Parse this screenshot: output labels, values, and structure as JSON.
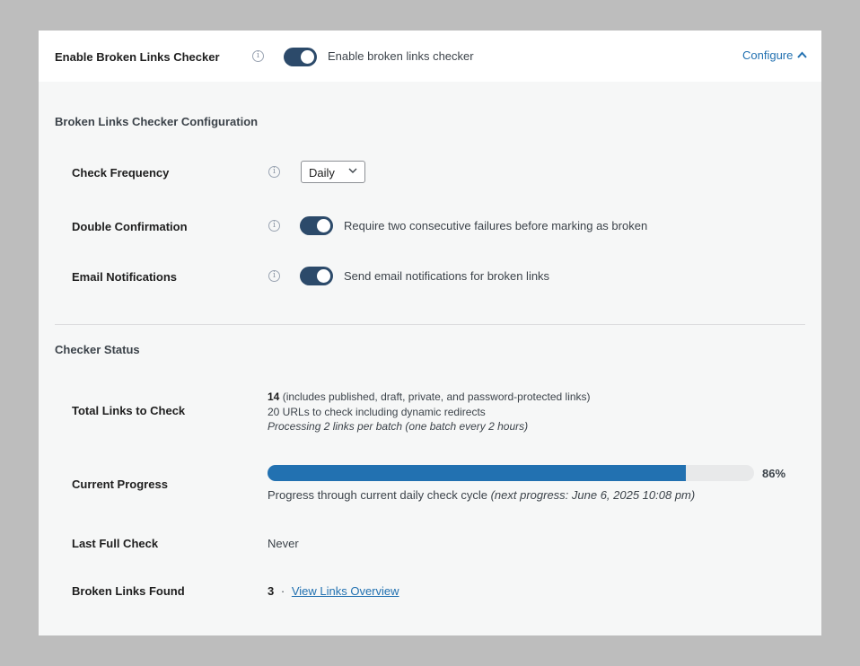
{
  "header": {
    "title": "Enable Broken Links Checker",
    "toggle_label": "Enable broken links checker",
    "toggle_on": true,
    "configure_label": "Configure"
  },
  "config": {
    "section_title": "Broken Links Checker Configuration",
    "check_frequency": {
      "label": "Check Frequency",
      "selected": "Daily"
    },
    "double_confirmation": {
      "label": "Double Confirmation",
      "toggle_label": "Require two consecutive failures before marking as broken",
      "on": true
    },
    "email_notifications": {
      "label": "Email Notifications",
      "toggle_label": "Send email notifications for broken links",
      "on": true
    }
  },
  "status": {
    "section_title": "Checker Status",
    "total_links": {
      "label": "Total Links to Check",
      "count": "14",
      "count_note": "(includes published, draft, private, and password-protected links)",
      "urls_line": "20 URLs to check including dynamic redirects",
      "batch_line": "Processing 2 links per batch (one batch every 2 hours)"
    },
    "current_progress": {
      "label": "Current Progress",
      "percent": 86,
      "percent_text": "86%",
      "caption": "Progress through current daily check cycle",
      "next_progress": "(next progress: June 6, 2025 10:08 pm)"
    },
    "last_full_check": {
      "label": "Last Full Check",
      "value": "Never"
    },
    "broken_links": {
      "label": "Broken Links Found",
      "count": "3",
      "separator": "·",
      "link_text": "View Links Overview"
    }
  },
  "colors": {
    "accent": "#2271b1",
    "toggle": "#2c4a6a",
    "panel_bg": "#f6f7f7",
    "outer_bg": "#bdbdbd"
  }
}
